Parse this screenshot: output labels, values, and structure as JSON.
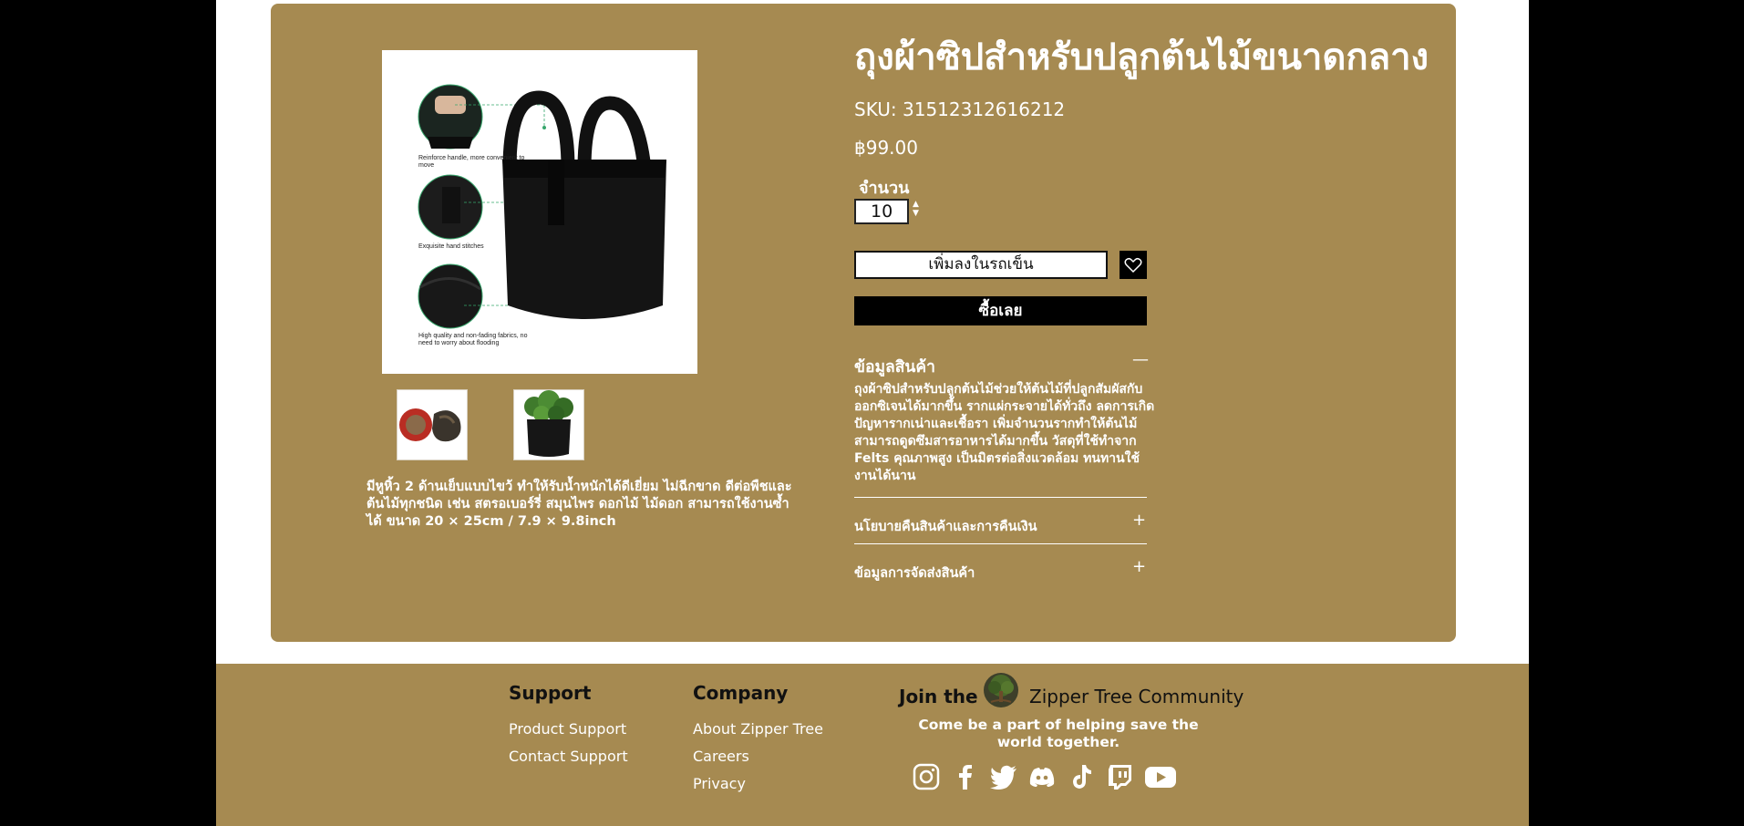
{
  "product": {
    "title": "ถุงผ้าซิปสำหรับปลูกต้นไม้ขนาดกลาง",
    "sku": "SKU: 31512312616212",
    "price": "฿99.00",
    "quantity_label": "จำนวน",
    "quantity_value": "10",
    "add_to_cart_label": "เพิ่มลงในรถเข็น",
    "buy_now_label": "ซื้อเลย",
    "short_description": "มีหูหิ้ว 2 ด้านเย็บแบบไขว้ ทำให้รับน้ำหนักได้ดีเยี่ยม ไม่ฉีกขาด ดีต่อพืชและต้นไม้ทุกชนิด เช่น สตรอเบอร์รี่ สมุนไพร ดอกไม้ ไม้ดอก สามารถใช้งานซ้ำได้  ขนาด 20 × 25cm / 7.9 × 9.8inch",
    "image_callouts": [
      "Reinforce handle, more convenient to move",
      "Exquisite hand stitches",
      "High quality and non-fading fabrics, no need to worry about flooding"
    ]
  },
  "accordion": {
    "info_title": "ข้อมูลสินค้า",
    "info_body": "ถุงผ้าซิปสำหรับปลูกต้นไม้ช่วยให้ต้นไม้ที่ปลูกสัมผัสกับออกซิเจนได้มากขึ้น รากแผ่กระจายได้ทั่วถึง ลดการเกิดปัญหารากเน่าและเชื้อรา เพิ่มจำนวนรากทำให้ต้นไม้สามารถดูดซึมสารอาหารได้มากขึ้น วัสดุที่ใช้ทำจาก Felts คุณภาพสูง เป็นมิตรต่อสิ่งแวดล้อม ทนทานใช้งานได้นาน",
    "return_title": "นโยบายคืนสินค้าและการคืนเงิน",
    "shipping_title": "ข้อมูลการจัดส่งสินค้า",
    "collapse_symbol": "—",
    "expand_symbol": "+"
  },
  "footer": {
    "support_heading": "Support",
    "support_links": [
      "Product Support",
      "Contact Support"
    ],
    "company_heading": "Company",
    "company_links": [
      "About Zipper Tree",
      "Careers",
      "Privacy"
    ],
    "join_text": "Join the",
    "community_text": "Zipper Tree Community",
    "tagline": "Come be a part of helping save the world together.",
    "social_icons": [
      "instagram-icon",
      "facebook-icon",
      "twitter-icon",
      "discord-icon",
      "tiktok-icon",
      "twitch-icon",
      "youtube-icon"
    ]
  },
  "colors": {
    "brand_tan": "#a68a51",
    "page_white": "#ffffff",
    "frame_black": "#000000"
  }
}
